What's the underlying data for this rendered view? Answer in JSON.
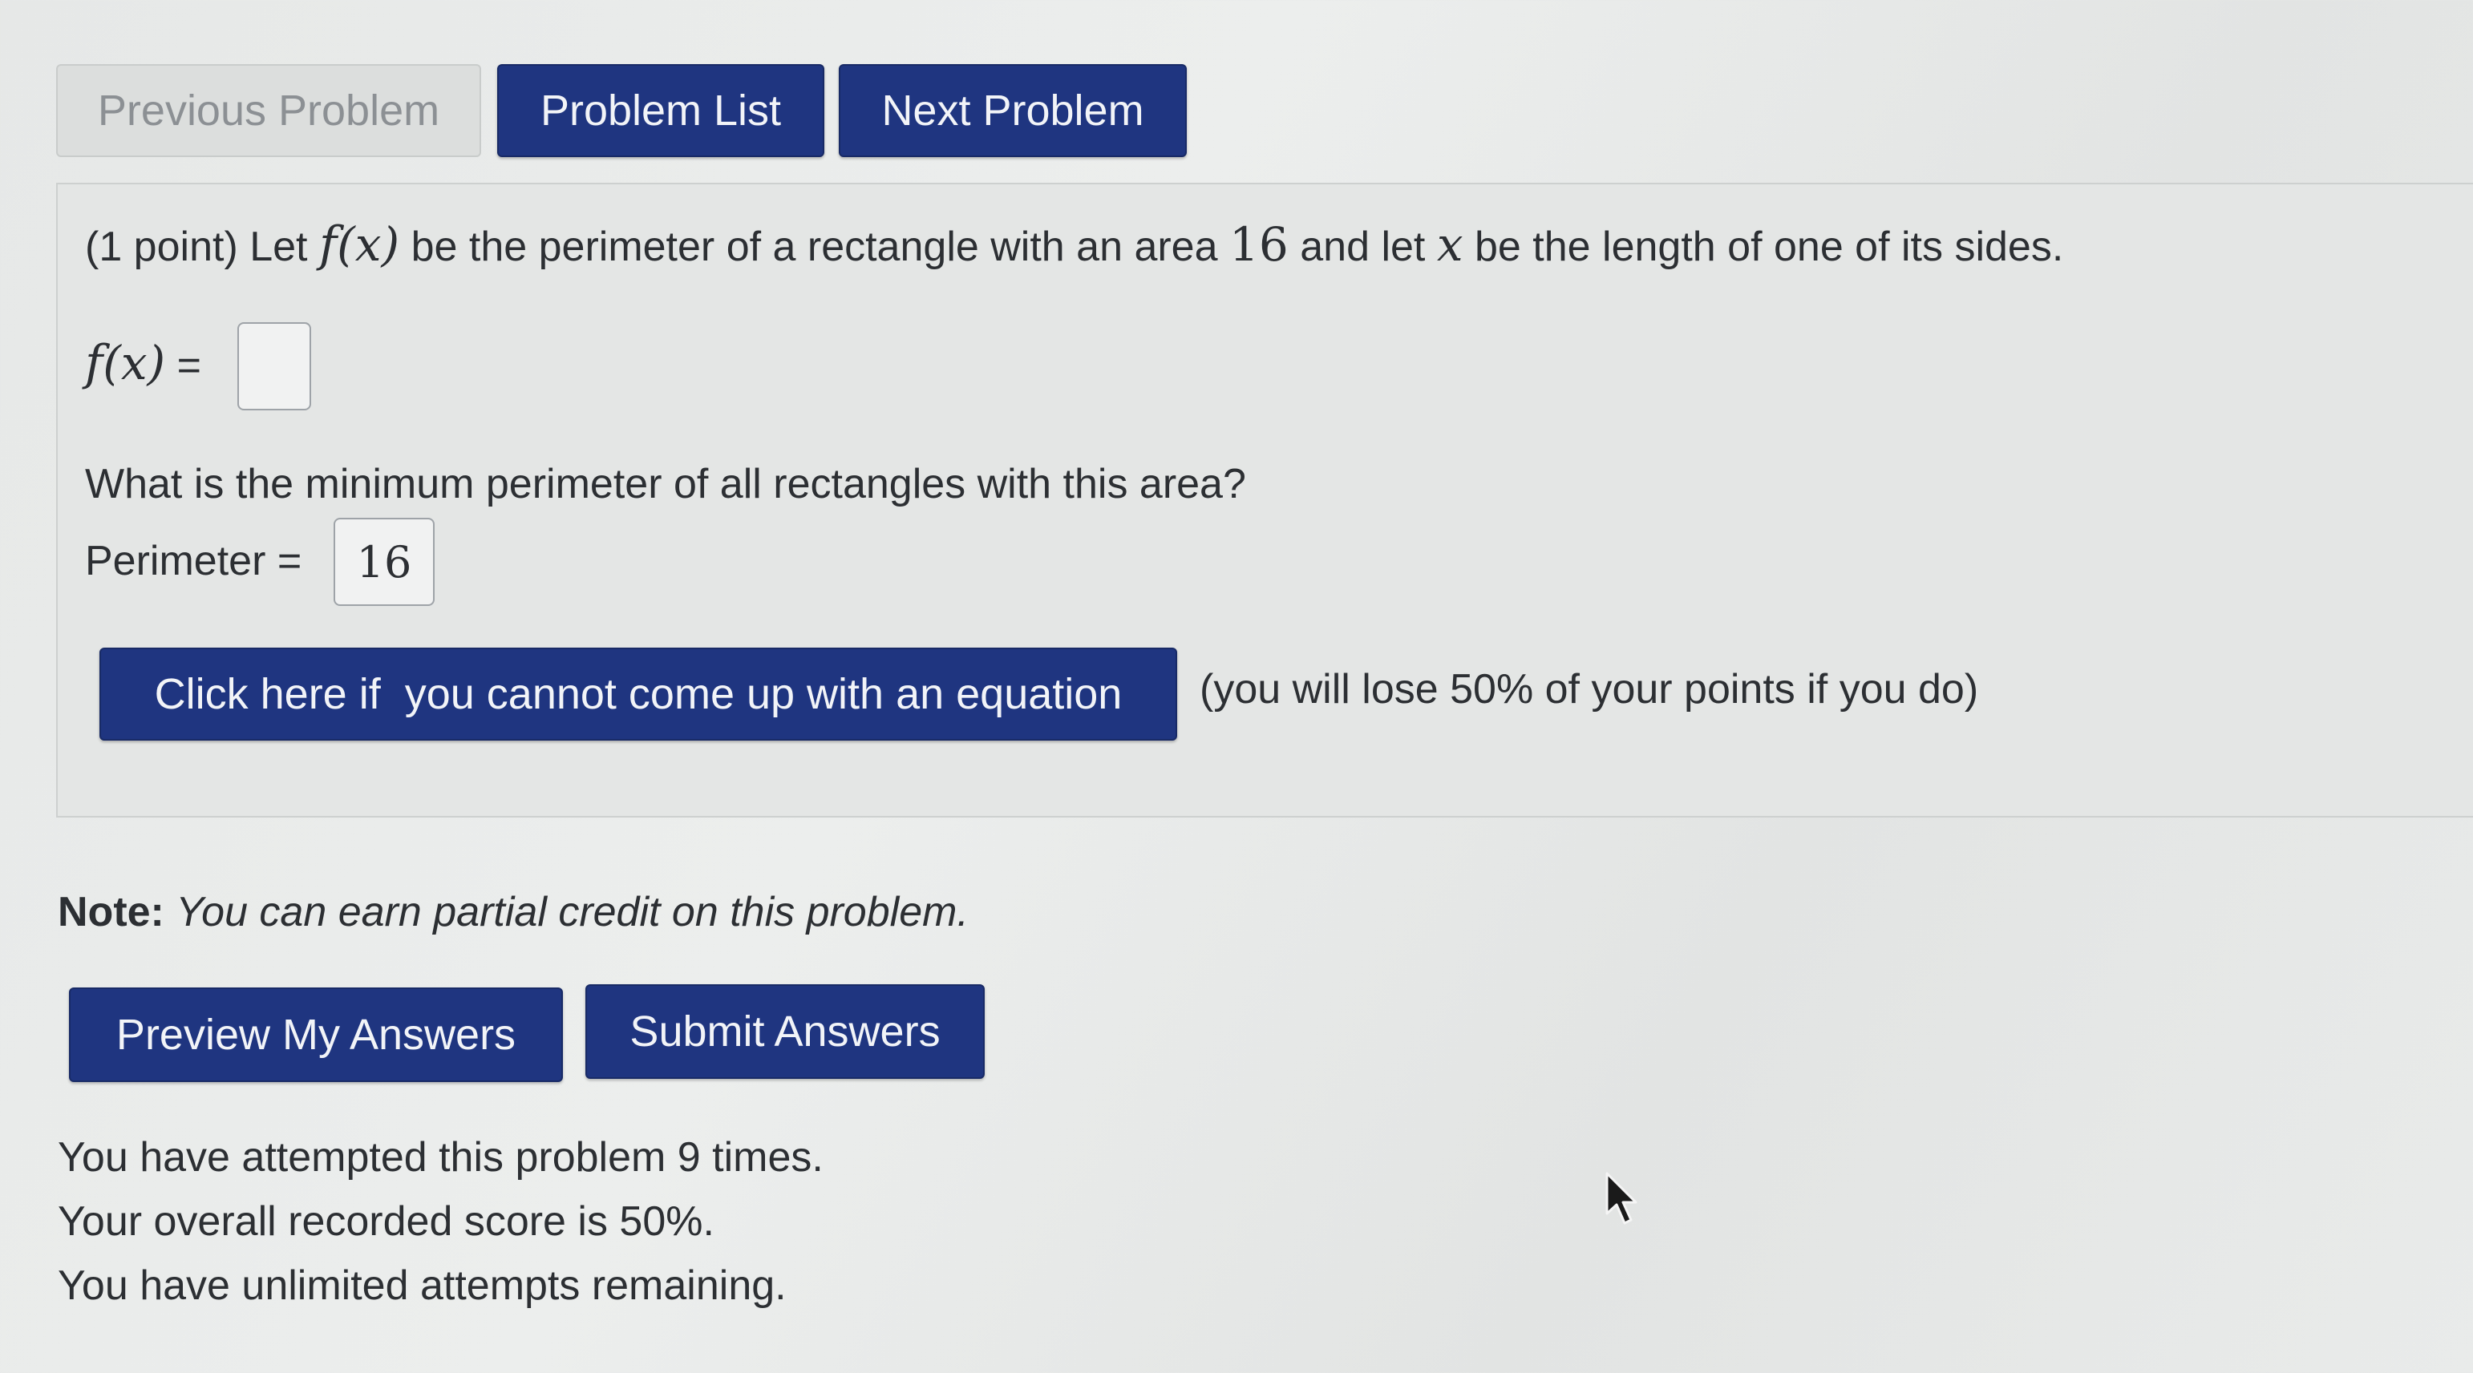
{
  "nav": {
    "previous_label": "Previous Problem",
    "list_label": "Problem List",
    "next_label": "Next Problem"
  },
  "problem": {
    "intro_points": "(1 point) Let",
    "f": "f",
    "fx_args": "(x)",
    "mid1": "be the perimeter of a rectangle with an area",
    "area_value": "16",
    "mid2": "and let",
    "var_x": "x",
    "end": "be the length of one of its sides.",
    "fx_label_f": "f",
    "fx_label_args": "(x)",
    "fx_equals": "=",
    "fx_answer_value": "",
    "question": "What is the minimum perimeter of all rectangles with this area?",
    "perimeter_label": "Perimeter =",
    "perimeter_answer_value": "16",
    "equation_button_label": "Click here if  you cannot come up with an equation",
    "equation_warning": "(you will lose 50% of your points if you do)"
  },
  "note": {
    "label": "Note:",
    "text": "You can earn partial credit on this problem."
  },
  "actions": {
    "preview_label": "Preview My Answers",
    "submit_label": "Submit Answers"
  },
  "status": {
    "attempts": "You have attempted this problem 9 times.",
    "score": "Your overall recorded score is 50%.",
    "remaining": "You have unlimited attempts remaining."
  },
  "colors": {
    "primary_button": "#1f3580",
    "disabled_button": "#dcdedd",
    "panel_background": "#e4e6e5"
  }
}
